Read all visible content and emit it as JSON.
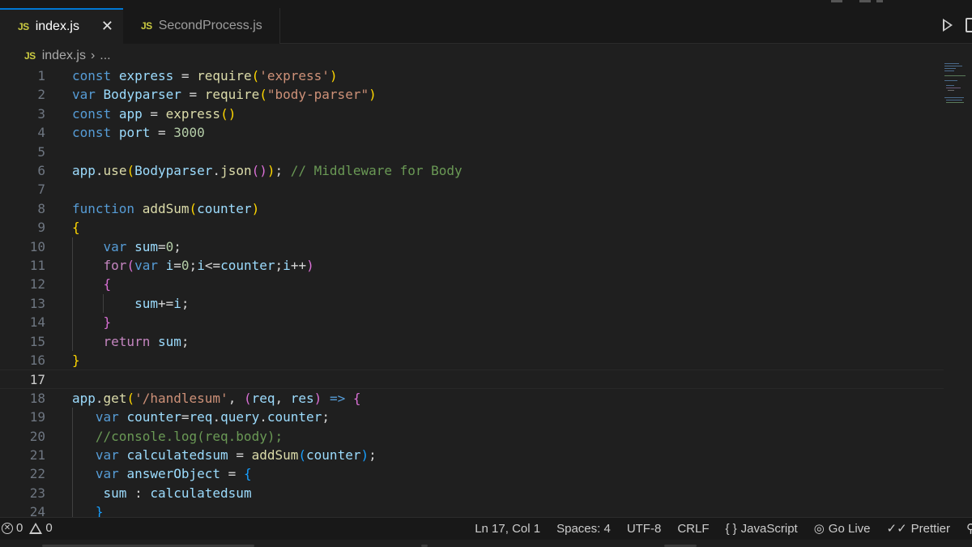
{
  "tabs": [
    {
      "icon": "JS",
      "label": "index.js",
      "active": true,
      "close": "✕"
    },
    {
      "icon": "JS",
      "label": "SecondProcess.js",
      "active": false
    }
  ],
  "breadcrumb": {
    "icon": "JS",
    "file": "index.js",
    "separator": "›",
    "rest": "..."
  },
  "editor": {
    "current_line": 17,
    "lines": [
      {
        "n": "1",
        "tokens": [
          [
            "kw",
            "const"
          ],
          [
            "op",
            " "
          ],
          [
            "var",
            "express"
          ],
          [
            "op",
            " = "
          ],
          [
            "fn",
            "require"
          ],
          [
            "b1",
            "("
          ],
          [
            "str",
            "'express'"
          ],
          [
            "b1",
            ")"
          ]
        ]
      },
      {
        "n": "2",
        "tokens": [
          [
            "kw",
            "var"
          ],
          [
            "op",
            " "
          ],
          [
            "var",
            "Bodyparser"
          ],
          [
            "op",
            " = "
          ],
          [
            "fn",
            "require"
          ],
          [
            "b1",
            "("
          ],
          [
            "str",
            "\"body-parser\""
          ],
          [
            "b1",
            ")"
          ]
        ]
      },
      {
        "n": "3",
        "tokens": [
          [
            "kw",
            "const"
          ],
          [
            "op",
            " "
          ],
          [
            "var",
            "app"
          ],
          [
            "op",
            " = "
          ],
          [
            "fn",
            "express"
          ],
          [
            "b1",
            "()"
          ]
        ]
      },
      {
        "n": "4",
        "tokens": [
          [
            "kw",
            "const"
          ],
          [
            "op",
            " "
          ],
          [
            "var",
            "port"
          ],
          [
            "op",
            " = "
          ],
          [
            "num",
            "3000"
          ]
        ]
      },
      {
        "n": "5",
        "tokens": []
      },
      {
        "n": "6",
        "tokens": [
          [
            "var",
            "app"
          ],
          [
            "op",
            "."
          ],
          [
            "fn",
            "use"
          ],
          [
            "b1",
            "("
          ],
          [
            "var",
            "Bodyparser"
          ],
          [
            "op",
            "."
          ],
          [
            "fn",
            "json"
          ],
          [
            "b2",
            "()"
          ],
          [
            "b1",
            ")"
          ],
          [
            "op",
            "; "
          ],
          [
            "cmt",
            "// Middleware for Body"
          ]
        ]
      },
      {
        "n": "7",
        "tokens": []
      },
      {
        "n": "8",
        "tokens": [
          [
            "kw",
            "function"
          ],
          [
            "op",
            " "
          ],
          [
            "fn",
            "addSum"
          ],
          [
            "b1",
            "("
          ],
          [
            "var",
            "counter"
          ],
          [
            "b1",
            ")"
          ]
        ]
      },
      {
        "n": "9",
        "tokens": [
          [
            "b1",
            "{"
          ]
        ]
      },
      {
        "n": "10",
        "tokens": [
          [
            "op",
            "    "
          ],
          [
            "kw",
            "var"
          ],
          [
            "op",
            " "
          ],
          [
            "var",
            "sum"
          ],
          [
            "op",
            "="
          ],
          [
            "num",
            "0"
          ],
          [
            "op",
            ";"
          ]
        ]
      },
      {
        "n": "11",
        "tokens": [
          [
            "op",
            "    "
          ],
          [
            "ctl",
            "for"
          ],
          [
            "b2",
            "("
          ],
          [
            "kw",
            "var"
          ],
          [
            "op",
            " "
          ],
          [
            "var",
            "i"
          ],
          [
            "op",
            "="
          ],
          [
            "num",
            "0"
          ],
          [
            "op",
            ";"
          ],
          [
            "var",
            "i"
          ],
          [
            "op",
            "<="
          ],
          [
            "var",
            "counter"
          ],
          [
            "op",
            ";"
          ],
          [
            "var",
            "i"
          ],
          [
            "op",
            "++"
          ],
          [
            "b2",
            ")"
          ]
        ]
      },
      {
        "n": "12",
        "tokens": [
          [
            "op",
            "    "
          ],
          [
            "b2",
            "{"
          ]
        ]
      },
      {
        "n": "13",
        "tokens": [
          [
            "op",
            "        "
          ],
          [
            "var",
            "sum"
          ],
          [
            "op",
            "+="
          ],
          [
            "var",
            "i"
          ],
          [
            "op",
            ";"
          ]
        ]
      },
      {
        "n": "14",
        "tokens": [
          [
            "op",
            "    "
          ],
          [
            "b2",
            "}"
          ]
        ]
      },
      {
        "n": "15",
        "tokens": [
          [
            "op",
            "    "
          ],
          [
            "ctl",
            "return"
          ],
          [
            "op",
            " "
          ],
          [
            "var",
            "sum"
          ],
          [
            "op",
            ";"
          ]
        ]
      },
      {
        "n": "16",
        "tokens": [
          [
            "b1",
            "}"
          ]
        ]
      },
      {
        "n": "17",
        "tokens": []
      },
      {
        "n": "18",
        "tokens": [
          [
            "var",
            "app"
          ],
          [
            "op",
            "."
          ],
          [
            "fn",
            "get"
          ],
          [
            "b1",
            "("
          ],
          [
            "str",
            "'/handlesum'"
          ],
          [
            "op",
            ", "
          ],
          [
            "b2",
            "("
          ],
          [
            "var",
            "req"
          ],
          [
            "op",
            ", "
          ],
          [
            "var",
            "res"
          ],
          [
            "b2",
            ")"
          ],
          [
            "op",
            " "
          ],
          [
            "kw",
            "=>"
          ],
          [
            "op",
            " "
          ],
          [
            "b2",
            "{"
          ]
        ]
      },
      {
        "n": "19",
        "tokens": [
          [
            "op",
            "   "
          ],
          [
            "kw",
            "var"
          ],
          [
            "op",
            " "
          ],
          [
            "var",
            "counter"
          ],
          [
            "op",
            "="
          ],
          [
            "var",
            "req"
          ],
          [
            "op",
            "."
          ],
          [
            "var",
            "query"
          ],
          [
            "op",
            "."
          ],
          [
            "var",
            "counter"
          ],
          [
            "op",
            ";"
          ]
        ]
      },
      {
        "n": "20",
        "tokens": [
          [
            "op",
            "   "
          ],
          [
            "cmt",
            "//console.log(req.body);"
          ]
        ]
      },
      {
        "n": "21",
        "tokens": [
          [
            "op",
            "   "
          ],
          [
            "kw",
            "var"
          ],
          [
            "op",
            " "
          ],
          [
            "var",
            "calculatedsum"
          ],
          [
            "op",
            " = "
          ],
          [
            "fn",
            "addSum"
          ],
          [
            "b3",
            "("
          ],
          [
            "var",
            "counter"
          ],
          [
            "b3",
            ")"
          ],
          [
            "op",
            ";"
          ]
        ]
      },
      {
        "n": "22",
        "tokens": [
          [
            "op",
            "   "
          ],
          [
            "kw",
            "var"
          ],
          [
            "op",
            " "
          ],
          [
            "var",
            "answerObject"
          ],
          [
            "op",
            " = "
          ],
          [
            "b3",
            "{"
          ]
        ]
      },
      {
        "n": "23",
        "tokens": [
          [
            "op",
            "    "
          ],
          [
            "var",
            "sum"
          ],
          [
            "op",
            " : "
          ],
          [
            "var",
            "calculatedsum"
          ]
        ]
      },
      {
        "n": "24",
        "tokens": [
          [
            "op",
            "   "
          ],
          [
            "b3",
            "}"
          ]
        ]
      }
    ]
  },
  "statusbar": {
    "errors": "0",
    "warnings": "0",
    "position": "Ln 17, Col 1",
    "spaces": "Spaces: 4",
    "encoding": "UTF-8",
    "eol": "CRLF",
    "language_icon": "{ }",
    "language": "JavaScript",
    "golive_icon": "◎",
    "golive": "Go Live",
    "prettier_icon": "✓✓",
    "prettier": "Prettier"
  },
  "colors": {
    "accent": "#0078d4",
    "js_icon": "#cbcb41",
    "keyword": "#569cd6",
    "control": "#c586c0",
    "variable": "#9cdcfe",
    "function": "#dcdcaa",
    "string": "#ce9178",
    "number": "#b5cea8",
    "comment": "#6a9955"
  },
  "icons": [
    "close-icon",
    "run-icon",
    "split-editor-icon",
    "error-icon",
    "warning-icon",
    "braces-icon",
    "broadcast-icon",
    "double-check-icon",
    "accounts-icon"
  ]
}
